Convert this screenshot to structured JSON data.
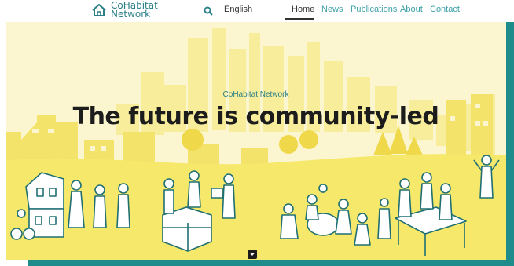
{
  "header": {
    "logo_line1": "CoHabitat",
    "logo_line2": "Network",
    "language": "English",
    "nav": [
      "Home",
      "News",
      "Publications",
      "About",
      "Contact"
    ],
    "active_nav": "Home"
  },
  "hero": {
    "subtitle": "CoHabitat Network",
    "title": "The future is community-led"
  },
  "colors": {
    "accent": "#2b7f86",
    "hero_bg": "#fbf6cf",
    "hero_yellow": "#f6e86a",
    "frame_teal": "#1f8c8c"
  },
  "icons": [
    "house-logo-icon",
    "search-icon",
    "chevron-down-icon"
  ]
}
